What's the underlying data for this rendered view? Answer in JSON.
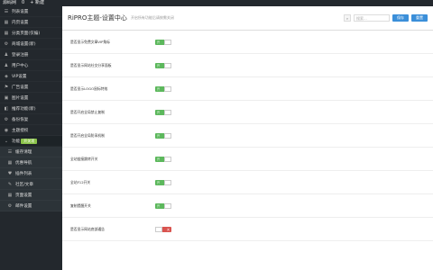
{
  "topbar": {
    "site_name": "源码网",
    "comments": "0",
    "new_label": "+ 新建"
  },
  "sidebar": {
    "items": [
      {
        "icon": "list-icon",
        "glyph": "☰",
        "label": "列表设置"
      },
      {
        "icon": "grid-icon",
        "glyph": "▦",
        "label": "内页设置"
      },
      {
        "icon": "grid-icon",
        "glyph": "▦",
        "label": "分类页面(仅编)"
      },
      {
        "icon": "gear-icon",
        "glyph": "⚙",
        "label": "商城设置(新)"
      },
      {
        "icon": "user-icon",
        "glyph": "♟",
        "label": "登录注册"
      },
      {
        "icon": "user-icon",
        "glyph": "♟",
        "label": "用户中心"
      },
      {
        "icon": "badge-icon",
        "glyph": "◈",
        "label": "VIP设置"
      },
      {
        "icon": "flag-icon",
        "glyph": "⚑",
        "label": "广告设置"
      },
      {
        "icon": "image-icon",
        "glyph": "▣",
        "label": "图片设置"
      },
      {
        "icon": "gift-icon",
        "glyph": "◧",
        "label": "推荐功能(新)"
      },
      {
        "icon": "gear-icon",
        "glyph": "⚙",
        "label": "备份恢复"
      },
      {
        "icon": "eye-icon",
        "glyph": "◉",
        "label": "主题授权"
      }
    ],
    "active": {
      "label": "功能",
      "badge": "开关项"
    },
    "sub_items": [
      {
        "icon": "list-icon",
        "glyph": "☰",
        "label": "缓存清理"
      },
      {
        "icon": "grid-icon",
        "glyph": "▦",
        "label": "优惠导航"
      },
      {
        "icon": "heart-icon",
        "glyph": "♥",
        "label": "插件列表"
      },
      {
        "icon": "pencil-icon",
        "glyph": "✎",
        "label": "社区/文章"
      },
      {
        "icon": "grid-icon",
        "glyph": "▦",
        "label": "页面设置"
      },
      {
        "icon": "gear-icon",
        "glyph": "⚙",
        "label": "邮件设置"
      }
    ]
  },
  "header": {
    "title": "RiPRO主题-设置中心",
    "subtitle": "开启所有功能后请按需关闭",
    "search_placeholder": "搜索...",
    "save_label": "保存",
    "reset_label": "重置"
  },
  "rows": [
    {
      "label": "是否显示免费文章VIP角标",
      "state": "on"
    },
    {
      "label": "是否显示网站社交分享面板",
      "state": "on"
    },
    {
      "label": "是否显示LOGO鼠标特效",
      "state": "on"
    },
    {
      "label": "是否开启全局禁止复制",
      "state": "on"
    },
    {
      "label": "是否开启全局防采机制",
      "state": "on"
    },
    {
      "label": "全站链接跳转开关",
      "state": "on"
    },
    {
      "label": "全站F12开关",
      "state": "on"
    },
    {
      "label": "复制提醒开关",
      "state": "on"
    },
    {
      "label": "是否显示网站底部通告",
      "state": "off"
    }
  ],
  "toggle_text": {
    "on": "开",
    "off": "关"
  },
  "colors": {
    "on": "#5cb85c",
    "off": "#d9534f",
    "accent": "#3b8fd9"
  }
}
